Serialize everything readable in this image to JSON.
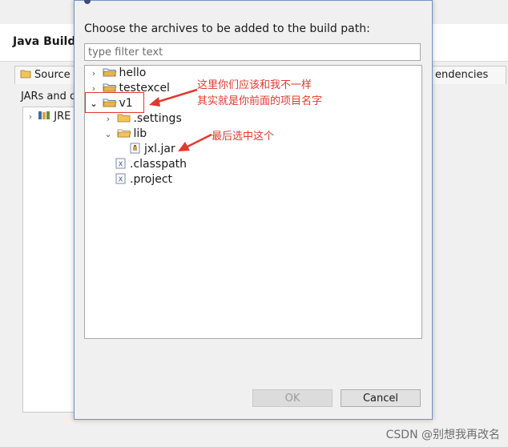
{
  "background": {
    "title": "Java Build",
    "tabs": [
      "Source",
      "endencies"
    ],
    "content_label": "JARs and c",
    "tree_item": "JRE"
  },
  "dialog": {
    "message": "Choose the archives to be added to the build path:",
    "filter_placeholder": "type filter text",
    "tree": {
      "hello": "hello",
      "testexcel": "testexcel",
      "v1": "v1",
      "settings": ".settings",
      "lib": "lib",
      "jar": "jxl.jar",
      "classpath": ".classpath",
      "project": ".project"
    },
    "ok_label": "OK",
    "cancel_label": "Cancel"
  },
  "annotations": {
    "line1": "这里你们应该和我不一样",
    "line2": "其实就是你前面的项目名字",
    "line3": "最后选中这个"
  },
  "watermark": "CSDN @别想我再改名",
  "colors": {
    "accent_red": "#e0392f",
    "dialog_border": "#6f94c6",
    "folder": "#e7b64a"
  }
}
